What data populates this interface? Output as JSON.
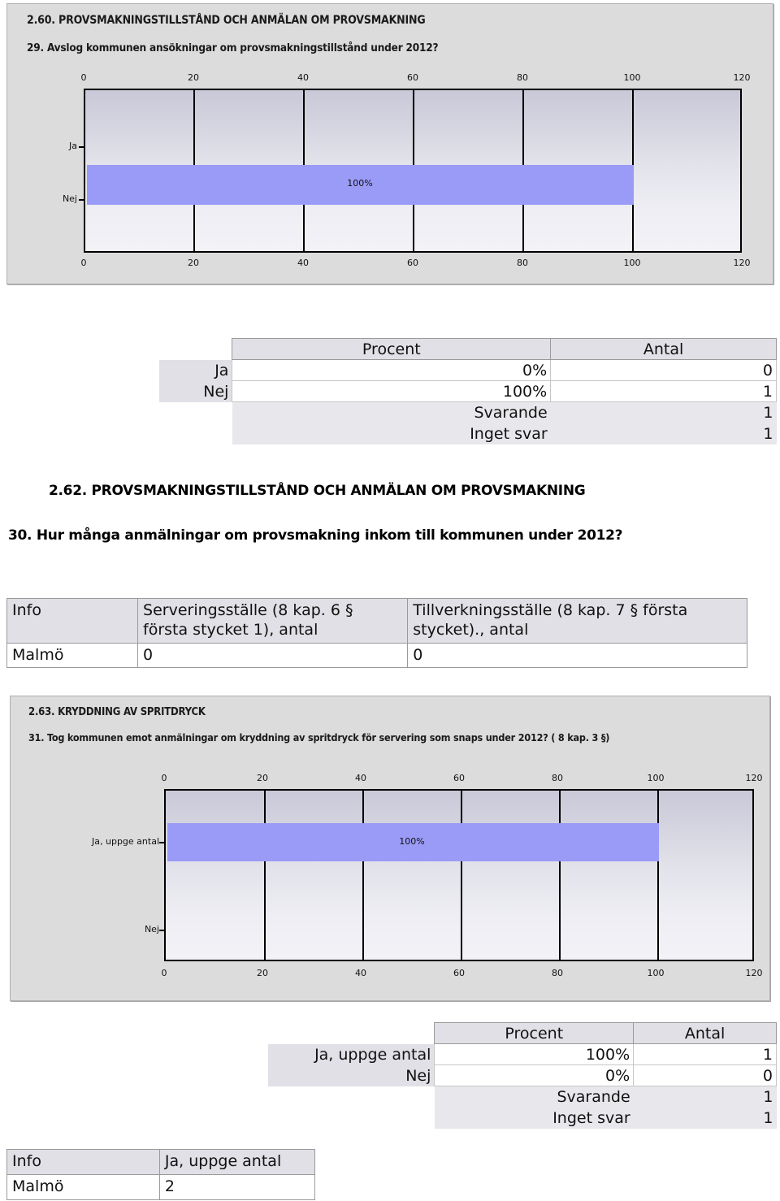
{
  "chart1": {
    "title": "2.60. PROVSMAKNINGSTILLSTÅND OCH ANMÄLAN OM PROVSMAKNING",
    "question": "29. Avslog kommunen  ansökningar om provsmakningstillstånd under 2012?",
    "chart_data": {
      "type": "bar",
      "orientation": "horizontal",
      "categories": [
        "Ja",
        "Nej"
      ],
      "values": [
        0,
        100
      ],
      "data_labels": [
        "",
        "100%"
      ],
      "title": "29. Avslog kommunen  ansökningar om provsmakningstillstånd under 2012?",
      "xlabel": "",
      "ylabel": "",
      "xlim": [
        0,
        120
      ],
      "xticks": [
        0,
        20,
        40,
        60,
        80,
        100,
        120
      ],
      "xtick_labels": [
        "0",
        "20",
        "40",
        "60",
        "80",
        "100",
        "120"
      ],
      "grid": true,
      "legend": "none",
      "axis_top_labels": true,
      "bar_color": "#9a9af7"
    }
  },
  "table1": {
    "columns": [
      "Procent",
      "Antal"
    ],
    "rows": [
      {
        "label": "Ja",
        "procent": "0%",
        "antal": "0"
      },
      {
        "label": "Nej",
        "procent": "100%",
        "antal": "1"
      }
    ],
    "summary": [
      {
        "label": "Svarande",
        "antal": "1"
      },
      {
        "label": "Inget svar",
        "antal": "1"
      }
    ]
  },
  "section2": {
    "heading": "2.62. PROVSMAKNINGSTILLSTÅND OCH ANMÄLAN OM PROVSMAKNING",
    "question": "30. Hur många anmälningar om provsmakning inkom till kommunen under 2012?"
  },
  "info_table1": {
    "headers": [
      "Info",
      "Serveringsställe (8 kap. 6 § första stycket 1), antal",
      "Tillverkningsställe (8 kap. 7 § första stycket)., antal"
    ],
    "rows": [
      {
        "info": "Malmö",
        "c1": "0",
        "c2": "0"
      }
    ]
  },
  "chart2": {
    "title": "2.63. KRYDDNING AV SPRITDRYCK",
    "question": "31. Tog kommunen emot anmälningar om kryddning av spritdryck för servering som snaps under 2012? ( 8 kap. 3 §)",
    "chart_data": {
      "type": "bar",
      "orientation": "horizontal",
      "categories": [
        "Ja, uppge antal",
        "Nej"
      ],
      "values": [
        100,
        0
      ],
      "data_labels": [
        "100%",
        ""
      ],
      "title": "31. Tog kommunen emot anmälningar om kryddning av spritdryck för servering som snaps under 2012? ( 8 kap. 3 §)",
      "xlabel": "",
      "ylabel": "",
      "xlim": [
        0,
        120
      ],
      "xticks": [
        0,
        20,
        40,
        60,
        80,
        100,
        120
      ],
      "xtick_labels": [
        "0",
        "20",
        "40",
        "60",
        "80",
        "100",
        "120"
      ],
      "grid": true,
      "legend": "none",
      "axis_top_labels": true,
      "bar_color": "#9a9af7"
    }
  },
  "table2": {
    "columns": [
      "Procent",
      "Antal"
    ],
    "rows": [
      {
        "label": "Ja, uppge antal",
        "procent": "100%",
        "antal": "1"
      },
      {
        "label": "Nej",
        "procent": "0%",
        "antal": "0"
      }
    ],
    "summary": [
      {
        "label": "Svarande",
        "antal": "1"
      },
      {
        "label": "Inget svar",
        "antal": "1"
      }
    ]
  },
  "info_table2": {
    "headers": [
      "Info",
      "Ja, uppge antal"
    ],
    "rows": [
      {
        "info": "Malmö",
        "c1": "2"
      }
    ]
  }
}
